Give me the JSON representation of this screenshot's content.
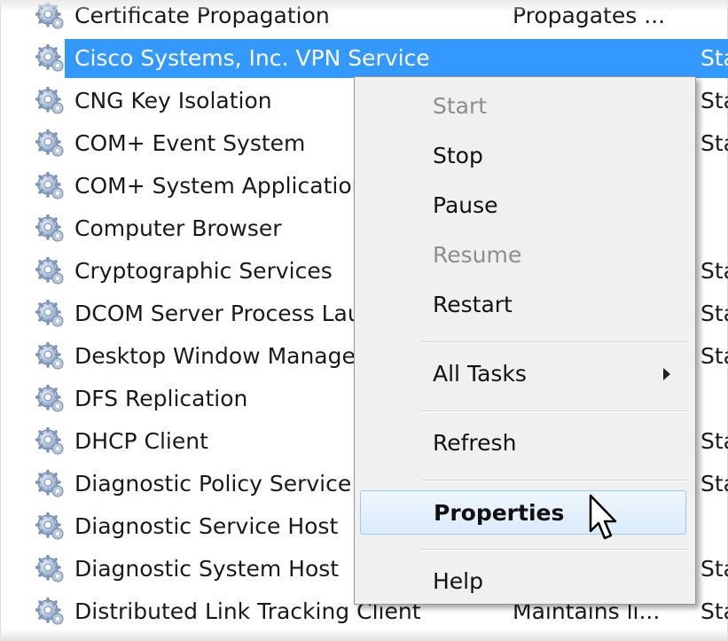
{
  "services": [
    {
      "name": "Certificate Propagation",
      "description": "Propagates ...",
      "status": ""
    },
    {
      "name": "Cisco Systems, Inc. VPN Service",
      "description": "",
      "status": "Sta",
      "selected": true
    },
    {
      "name": "CNG Key Isolation",
      "description": "",
      "status": "Sta"
    },
    {
      "name": "COM+ Event System",
      "description": "",
      "status": "Sta"
    },
    {
      "name": "COM+ System Application",
      "description": "",
      "status": ""
    },
    {
      "name": "Computer Browser",
      "description": "",
      "status": ""
    },
    {
      "name": "Cryptographic Services",
      "description": "",
      "status": "Sta"
    },
    {
      "name": "DCOM Server Process Launcher",
      "description": "",
      "status": "Sta"
    },
    {
      "name": "Desktop Window Manager",
      "description": "",
      "status": "Sta"
    },
    {
      "name": "DFS Replication",
      "description": "",
      "status": ""
    },
    {
      "name": "DHCP Client",
      "description": "",
      "status": "Sta"
    },
    {
      "name": "Diagnostic Policy Service",
      "description": "",
      "status": "Sta"
    },
    {
      "name": "Diagnostic Service Host",
      "description": "",
      "status": ""
    },
    {
      "name": "Diagnostic System Host",
      "description": "",
      "status": "Sta"
    },
    {
      "name": "Distributed Link Tracking Client",
      "description": "Maintains li...",
      "status": "Sta"
    }
  ],
  "context_menu": {
    "items": [
      {
        "label": "Start",
        "disabled": true
      },
      {
        "label": "Stop"
      },
      {
        "label": "Pause"
      },
      {
        "label": "Resume",
        "disabled": true
      },
      {
        "label": "Restart"
      },
      {
        "separator": true
      },
      {
        "label": "All Tasks",
        "submenu": true
      },
      {
        "separator": true
      },
      {
        "label": "Refresh"
      },
      {
        "separator": true
      },
      {
        "label": "Properties",
        "bold": true,
        "hover": true
      },
      {
        "separator": true
      },
      {
        "label": "Help"
      }
    ]
  },
  "colors": {
    "selection": "#3399ff",
    "menu_background": "#f0f0f0",
    "menu_hover": "#dcecfb",
    "disabled_text": "#8d8d8d"
  },
  "icons": {
    "service": "gears-icon",
    "cursor": "arrow-cursor-icon",
    "submenu": "submenu-arrow-icon"
  }
}
